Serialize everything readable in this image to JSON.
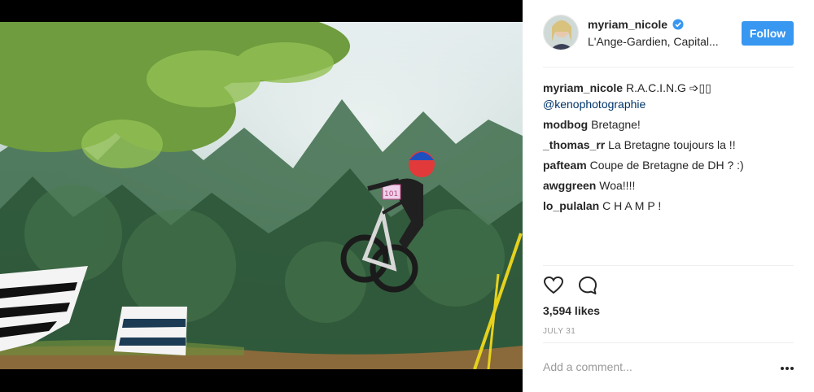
{
  "post": {
    "username": "myriam_nicole",
    "location": "L'Ange-Gardien, Capital...",
    "follow_label": "Follow",
    "comments": [
      {
        "user": "myriam_nicole",
        "text": "R.A.C.I.N.G ➩▯▯",
        "mention": "@kenophotographie"
      },
      {
        "user": "modbog",
        "text": "Bretagne!"
      },
      {
        "user": "_thomas_rr",
        "text": "La Bretagne toujours la !!"
      },
      {
        "user": "pafteam",
        "text": "Coupe de Bretagne de DH ? :)"
      },
      {
        "user": "awggreen",
        "text": "Woa!!!!"
      },
      {
        "user": "lo_pulalan",
        "text": "C H A M P !"
      }
    ],
    "likes": "3,594 likes",
    "date": "JULY 31",
    "add_comment_placeholder": "Add a comment...",
    "plate_number": "101"
  },
  "icons": {
    "verified": "verified-badge-icon",
    "like": "heart-icon",
    "comment": "comment-bubble-icon",
    "more": "more-options-icon"
  },
  "colors": {
    "accent": "#3897f0",
    "mention": "#003569",
    "muted": "#999999"
  }
}
